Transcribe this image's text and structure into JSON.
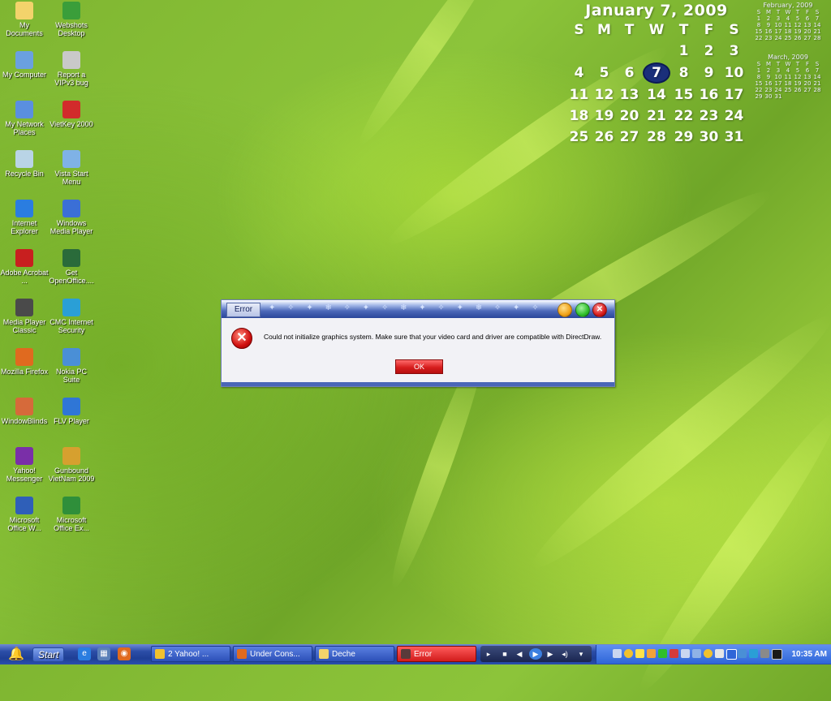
{
  "desktop": {
    "icons": [
      {
        "label": "My Documents",
        "icon": "folder-documents-icon",
        "color": "#f3d36b"
      },
      {
        "label": "Webshots Desktop",
        "icon": "webshots-icon",
        "color": "#3a9e3a"
      },
      {
        "label": "My Computer",
        "icon": "computer-icon",
        "color": "#6aa0e0"
      },
      {
        "label": "Report a VIPv3 bug",
        "icon": "report-bug-icon",
        "color": "#c9c9c9"
      },
      {
        "label": "My Network Places",
        "icon": "network-places-icon",
        "color": "#5a8fe0"
      },
      {
        "label": "VietKey 2000",
        "icon": "vietkey-icon",
        "color": "#d22b2b"
      },
      {
        "label": "Recycle Bin",
        "icon": "recycle-bin-icon",
        "color": "#b9d4e6"
      },
      {
        "label": "Vista Start Menu",
        "icon": "vista-start-icon",
        "color": "#7fb2e6"
      },
      {
        "label": "Internet Explorer",
        "icon": "internet-explorer-icon",
        "color": "#2a7de0"
      },
      {
        "label": "Windows Media Player",
        "icon": "media-player-icon",
        "color": "#3b6fd6"
      },
      {
        "label": "Adobe Acrobat ...",
        "icon": "adobe-acrobat-icon",
        "color": "#c81f1f"
      },
      {
        "label": "Get OpenOffice....",
        "icon": "openoffice-icon",
        "color": "#2a6b3a"
      },
      {
        "label": "Media Player Classic",
        "icon": "media-player-classic-icon",
        "color": "#4a4a4a"
      },
      {
        "label": "CMC Internet Security",
        "icon": "cmc-security-icon",
        "color": "#2a9fd6"
      },
      {
        "label": "Mozilla Firefox",
        "icon": "firefox-icon",
        "color": "#e06a1f"
      },
      {
        "label": "Nokia PC Suite",
        "icon": "nokia-pc-suite-icon",
        "color": "#4a8fd6"
      },
      {
        "label": "WindowBlinds",
        "icon": "windowblinds-icon",
        "color": "#d66a3a"
      },
      {
        "label": "FLV Player",
        "icon": "flv-player-icon",
        "color": "#2f76d6"
      },
      {
        "label": "Yahoo! Messenger",
        "icon": "yahoo-messenger-icon",
        "color": "#7a2fa8"
      },
      {
        "label": "Gunbound VietNam 2009",
        "icon": "gunbound-icon",
        "color": "#d6a02f"
      },
      {
        "label": "Microsoft Office W...",
        "icon": "ms-word-icon",
        "color": "#2f5fb8"
      },
      {
        "label": "Microsoft Office Ex...",
        "icon": "ms-excel-icon",
        "color": "#2f8f3a"
      }
    ]
  },
  "calendar": {
    "title": "January 7, 2009",
    "weekdays": [
      "S",
      "M",
      "T",
      "W",
      "T",
      "F",
      "S"
    ],
    "weeks": [
      [
        "",
        "",
        "",
        "",
        "1",
        "2",
        "3"
      ],
      [
        "4",
        "5",
        "6",
        "7",
        "8",
        "9",
        "10"
      ],
      [
        "11",
        "12",
        "13",
        "14",
        "15",
        "16",
        "17"
      ],
      [
        "18",
        "19",
        "20",
        "21",
        "22",
        "23",
        "24"
      ],
      [
        "25",
        "26",
        "27",
        "28",
        "29",
        "30",
        "31"
      ]
    ],
    "today": "7",
    "mini_feb": {
      "title": "February, 2009",
      "weekdays": [
        "S",
        "M",
        "T",
        "W",
        "T",
        "F",
        "S"
      ],
      "weeks": [
        [
          "1",
          "2",
          "3",
          "4",
          "5",
          "6",
          "7"
        ],
        [
          "8",
          "9",
          "10",
          "11",
          "12",
          "13",
          "14"
        ],
        [
          "15",
          "16",
          "17",
          "18",
          "19",
          "20",
          "21"
        ],
        [
          "22",
          "23",
          "24",
          "25",
          "26",
          "27",
          "28"
        ]
      ]
    },
    "mini_mar": {
      "title": "March, 2009",
      "weekdays": [
        "S",
        "M",
        "T",
        "W",
        "T",
        "F",
        "S"
      ],
      "weeks": [
        [
          "1",
          "2",
          "3",
          "4",
          "5",
          "6",
          "7"
        ],
        [
          "8",
          "9",
          "10",
          "11",
          "12",
          "13",
          "14"
        ],
        [
          "15",
          "16",
          "17",
          "18",
          "19",
          "20",
          "21"
        ],
        [
          "22",
          "23",
          "24",
          "25",
          "26",
          "27",
          "28"
        ],
        [
          "29",
          "30",
          "31",
          "",
          "",
          "",
          ""
        ]
      ]
    }
  },
  "dialog": {
    "title": "Error",
    "message": "Could not initialize graphics system. Make sure that your video card and driver are compatible with DirectDraw.",
    "ok_label": "OK"
  },
  "taskbar": {
    "start_label": "Start",
    "buttons": [
      {
        "label": "2 Yahoo! ...",
        "icon": "yahoo-messenger-icon",
        "color": "#f2c12e",
        "active": false
      },
      {
        "label": "Under Cons...",
        "icon": "firefox-icon",
        "color": "#e06a1f",
        "active": false
      },
      {
        "label": "Deche",
        "icon": "folder-icon",
        "color": "#f3d36b",
        "active": false
      },
      {
        "label": "Error",
        "icon": "app-window-icon",
        "color": "#5a3a3a",
        "active": true
      }
    ],
    "clock": "10:35 AM"
  },
  "colors": {
    "dialog_button": "#d71e1e",
    "today_highlight": "#1a2f7a"
  }
}
